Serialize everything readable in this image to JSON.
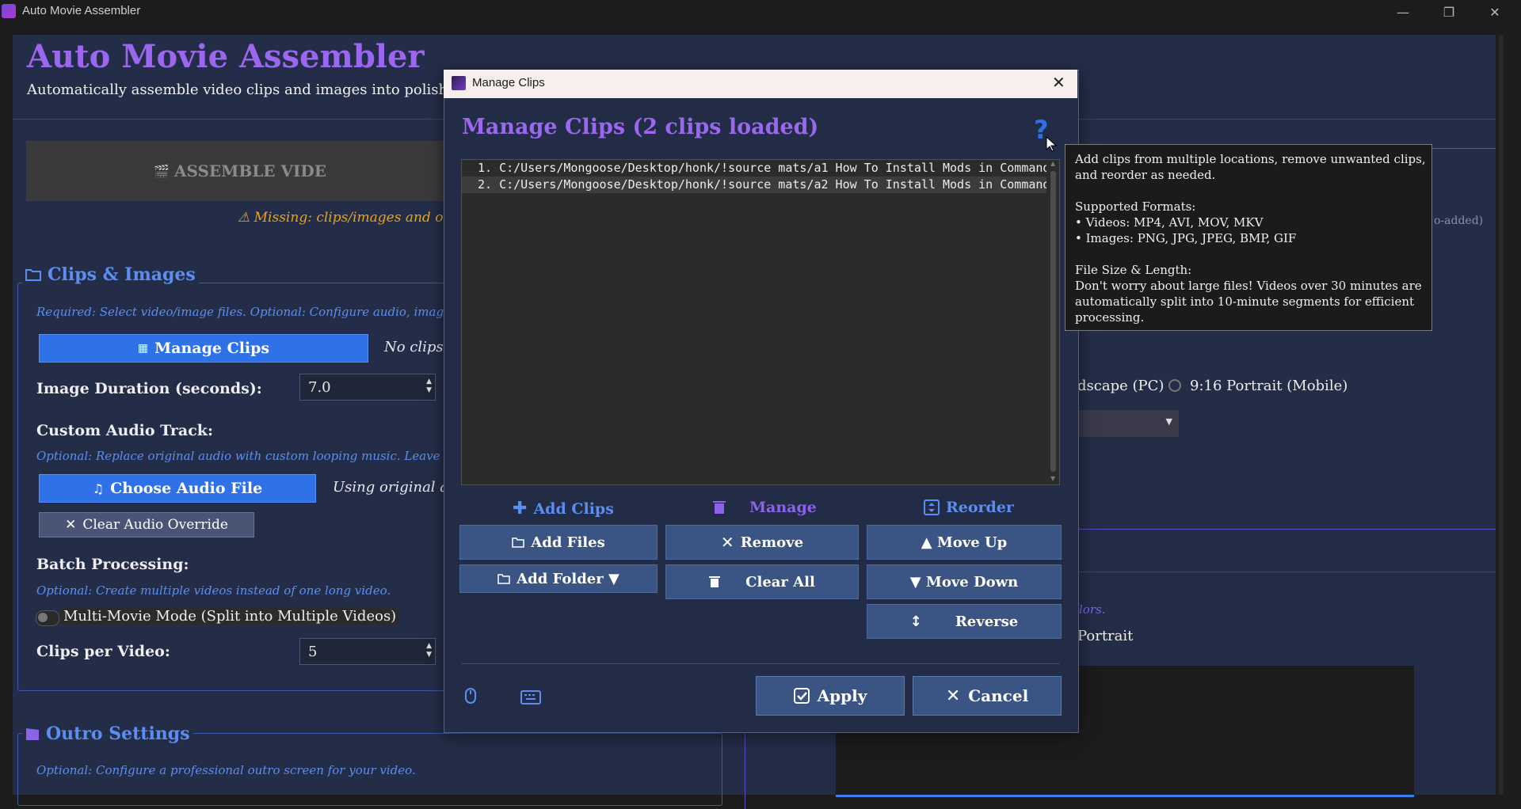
{
  "window": {
    "title": "Auto Movie Assembler",
    "controls": {
      "minimize": "—",
      "maximize": "❐",
      "close": "✕"
    }
  },
  "header": {
    "title": "Auto Movie Assembler",
    "subtitle": "Automatically assemble video clips and images into polished video"
  },
  "assemble": {
    "label": "ASSEMBLE VIDE",
    "missing_warning": "⚠ Missing: clips/images and out"
  },
  "clips_images": {
    "title": "Clips & Images",
    "hint": "Required: Select video/image files. Optional: Configure audio, image duratio",
    "manage_button": "Manage Clips",
    "no_clips": "No clips l",
    "image_duration_label": "Image Duration (seconds):",
    "image_duration_value": "7.0",
    "custom_audio_label": "Custom Audio Track:",
    "custom_audio_hint": "Optional: Replace original audio with custom looping music. Leave empty to",
    "choose_audio_button": "Choose Audio File",
    "using_original": "Using original auc",
    "clear_audio_button": "Clear Audio Override",
    "batch_label": "Batch Processing:",
    "batch_hint": "Optional: Create multiple videos instead of one long video.",
    "multi_movie_toggle": "Multi-Movie Mode (Split into Multiple Videos)",
    "clips_per_video_label": "Clips per Video:",
    "clips_per_video_value": "5"
  },
  "outro": {
    "title": "Outro Settings",
    "hint": "Optional: Configure a professional outro screen for your video."
  },
  "background_right": {
    "auto_added": "o-added)",
    "radio_landscape": "dscape (PC)",
    "radio_portrait": "9:16 Portrait (Mobile)",
    "colors_hint": "lors.",
    "portrait_label": "Portrait"
  },
  "dialog": {
    "title": "Manage Clips",
    "heading": "Manage Clips (2 clips loaded)",
    "help_glyph": "?",
    "clips": [
      "1. C:/Users/Mongoose/Desktop/honk/!source mats/a1 How To Install Mods in Command",
      "2. C:/Users/Mongoose/Desktop/honk/!source mats/a2 How To Install Mods in Command"
    ],
    "section_add": "Add Clips",
    "section_manage": "Manage",
    "section_reorder": "Reorder",
    "add_files": "Add Files",
    "add_folder": "Add Folder ▼",
    "remove": "Remove",
    "clear_all": "Clear All",
    "move_up": "▲ Move Up",
    "move_down": "▼ Move Down",
    "reverse": "Reverse",
    "apply": "Apply",
    "cancel": "Cancel"
  },
  "tooltip": {
    "lines": [
      "Add clips from multiple locations, remove unwanted clips,",
      "and reorder as needed.",
      "",
      "Supported Formats:",
      "• Videos: MP4, AVI, MOV, MKV",
      "• Images: PNG, JPG, JPEG, BMP, GIF",
      "",
      "File Size & Length:",
      "Don't worry about large files! Videos over 30 minutes are",
      "automatically split into 10-minute segments for efficient",
      "processing."
    ]
  },
  "colors": {
    "accent_purple": "#9b66f0",
    "accent_blue": "#2f72e8",
    "warning": "#e8a316",
    "panel_bg": "#242d48",
    "dialog_button": "#3a5483"
  }
}
